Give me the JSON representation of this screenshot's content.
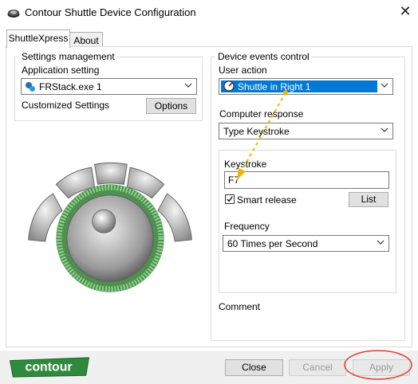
{
  "window": {
    "title": "Contour Shuttle Device Configuration",
    "close_glyph": "✕"
  },
  "tabs": [
    {
      "label": "ShuttleXpress",
      "active": true
    },
    {
      "label": "About",
      "active": false
    }
  ],
  "settings_management": {
    "legend": "Settings management",
    "application_label": "Application setting",
    "application_value": "FRStack.exe 1",
    "customized_label": "Customized Settings",
    "options_button": "Options"
  },
  "device_events": {
    "legend": "Device events control",
    "user_action_label": "User action",
    "user_action_value": "Shuttle in Right 1",
    "computer_response_label": "Computer response",
    "computer_response_value": "Type Keystroke",
    "keystroke_label": "Keystroke",
    "keystroke_value": "F7",
    "smart_release_label": "Smart release",
    "smart_release_checked": true,
    "list_button": "List",
    "frequency_label": "Frequency",
    "frequency_value": "60 Times per Second",
    "comment_label": "Comment"
  },
  "footer": {
    "logo_text": "contour",
    "close_button": "Close",
    "cancel_button": "Cancel",
    "apply_button": "Apply"
  },
  "colors": {
    "accent_blue": "#0078d7",
    "annotation_orange": "#f0b400",
    "annotation_red": "#e0413a",
    "device_green": "#6fbf6f",
    "logo_green": "#2e8b3e"
  },
  "icons": [
    "app-icon",
    "chevron-down-icon",
    "close-icon",
    "shuttle-selected-icon",
    "app-setting-icon",
    "checkmark-icon"
  ]
}
